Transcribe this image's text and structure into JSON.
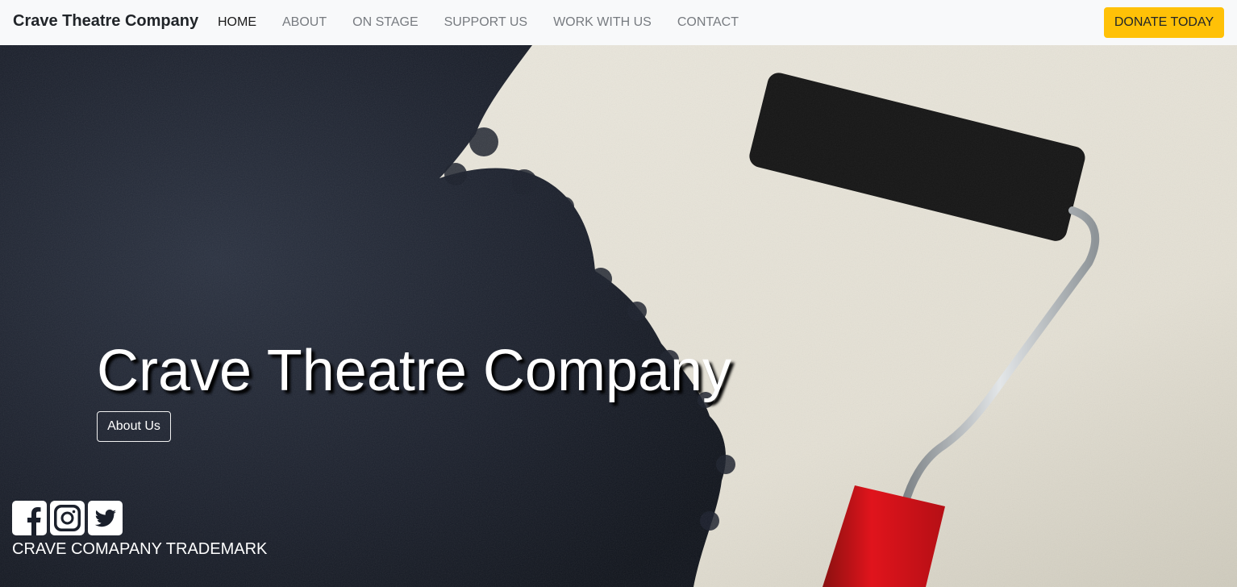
{
  "navbar": {
    "brand": "Crave Theatre Company",
    "links": [
      {
        "label": "HOME",
        "active": true
      },
      {
        "label": "ABOUT"
      },
      {
        "label": "ON STAGE"
      },
      {
        "label": "SUPPORT US"
      },
      {
        "label": "WORK WITH US"
      },
      {
        "label": "CONTACT"
      }
    ],
    "donate_label": "DONATE TODAY",
    "donate_color": "#ffc107"
  },
  "hero": {
    "title": "Crave Theatre Company",
    "button_label": "About Us",
    "background_image": "paint-roller-dark-paint-wall",
    "social_icons": [
      "facebook-icon",
      "instagram-icon",
      "twitter-icon"
    ],
    "trademark": "CRAVE COMAPANY TRADEMARK"
  }
}
